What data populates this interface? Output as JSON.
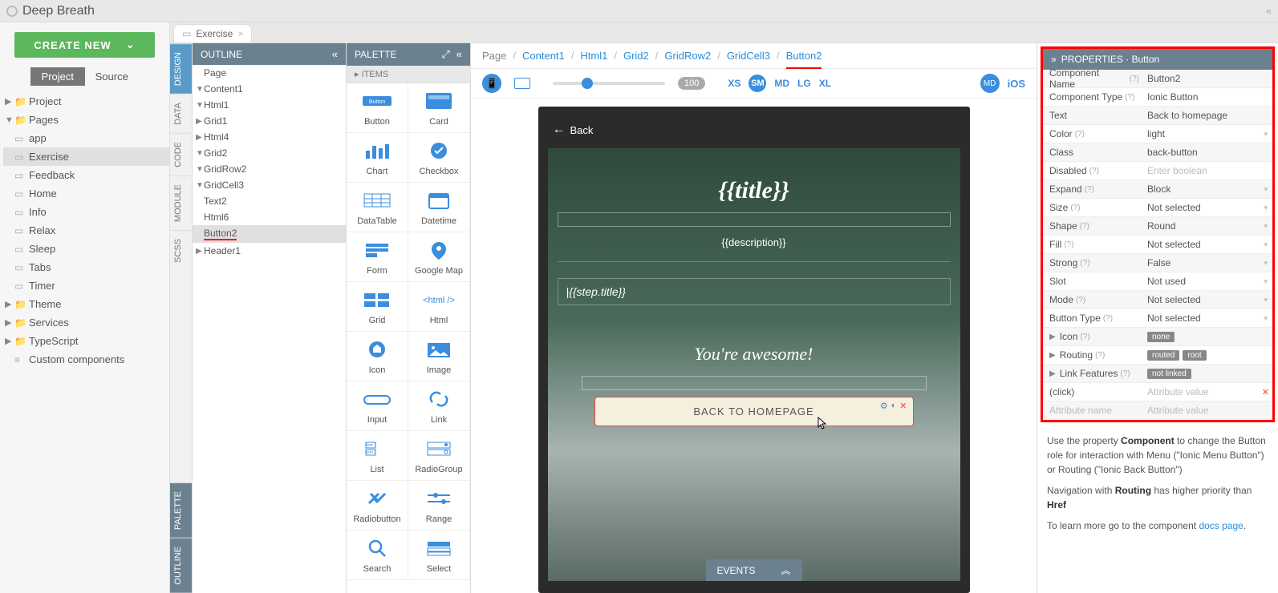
{
  "app": {
    "title": "Deep Breath"
  },
  "left": {
    "create": "CREATE NEW",
    "tabs": {
      "project": "Project",
      "source": "Source"
    },
    "tree": [
      {
        "a": "▶",
        "ico": "📁",
        "label": "Project",
        "ind": 1
      },
      {
        "a": "▼",
        "ico": "📁",
        "label": "Pages",
        "ind": 1
      },
      {
        "a": "",
        "ico": "▭",
        "label": "app",
        "ind": 2
      },
      {
        "a": "",
        "ico": "▭",
        "label": "Exercise",
        "ind": 2,
        "sel": true
      },
      {
        "a": "",
        "ico": "▭",
        "label": "Feedback",
        "ind": 2
      },
      {
        "a": "",
        "ico": "▭",
        "label": "Home",
        "ind": 2
      },
      {
        "a": "",
        "ico": "▭",
        "label": "Info",
        "ind": 2
      },
      {
        "a": "",
        "ico": "▭",
        "label": "Relax",
        "ind": 2
      },
      {
        "a": "",
        "ico": "▭",
        "label": "Sleep",
        "ind": 2
      },
      {
        "a": "",
        "ico": "▭",
        "label": "Tabs",
        "ind": 2
      },
      {
        "a": "",
        "ico": "▭",
        "label": "Timer",
        "ind": 2
      },
      {
        "a": "▶",
        "ico": "📁",
        "label": "Theme",
        "ind": 1
      },
      {
        "a": "▶",
        "ico": "📁",
        "label": "Services",
        "ind": 1
      },
      {
        "a": "▶",
        "ico": "📁",
        "label": "TypeScript",
        "ind": 1
      },
      {
        "a": "",
        "ico": "≡",
        "label": "Custom components",
        "ind": 1
      }
    ]
  },
  "tab": {
    "name": "Exercise"
  },
  "vtabs": [
    "DESIGN",
    "DATA",
    "CODE",
    "MODULE",
    "SCSS",
    "PALETTE",
    "OUTLINE"
  ],
  "outline": {
    "title": "OUTLINE",
    "items": [
      {
        "a": "",
        "ind": 0,
        "label": "Page"
      },
      {
        "a": "▼",
        "ind": 1,
        "label": "Content1"
      },
      {
        "a": "▼",
        "ind": 2,
        "label": "Html1"
      },
      {
        "a": "▶",
        "ind": 3,
        "label": "Grid1"
      },
      {
        "a": "▶",
        "ind": 3,
        "label": "Html4"
      },
      {
        "a": "▼",
        "ind": 3,
        "label": "Grid2"
      },
      {
        "a": "▼",
        "ind": 4,
        "label": "GridRow2"
      },
      {
        "a": "▼",
        "ind": 5,
        "label": "GridCell3"
      },
      {
        "a": "",
        "ind": 6,
        "label": "Text2"
      },
      {
        "a": "",
        "ind": 6,
        "label": "Html6"
      },
      {
        "a": "",
        "ind": 6,
        "label": "Button2",
        "sel": true,
        "u": true
      },
      {
        "a": "▶",
        "ind": 1,
        "label": "Header1"
      }
    ]
  },
  "palette": {
    "title": "PALETTE",
    "sub": "ITEMS",
    "items": [
      "Button",
      "Card",
      "Chart",
      "Checkbox",
      "DataTable",
      "Datetime",
      "Form",
      "Google Map",
      "Grid",
      "Html",
      "Icon",
      "Image",
      "Input",
      "Link",
      "List",
      "RadioGroup",
      "Radiobutton",
      "Range",
      "Search",
      "Select"
    ]
  },
  "bc": [
    "Page",
    "Content1",
    "Html1",
    "Grid2",
    "GridRow2",
    "GridCell3",
    "Button2"
  ],
  "toolbar": {
    "pill": "100",
    "sizes": [
      "XS",
      "SM",
      "MD",
      "LG",
      "XL"
    ],
    "md": "MD",
    "ios": "iOS"
  },
  "preview": {
    "back": "Back",
    "title": "{{title}}",
    "desc": "{{description}}",
    "step": "{{step.title}}",
    "awesome": "You're awesome!",
    "btn": "BACK TO HOMEPAGE"
  },
  "events": "EVENTS",
  "props": {
    "title": "PROPERTIES · Button",
    "rows": [
      {
        "k": "Component Name",
        "q": true,
        "v": "Button2"
      },
      {
        "k": "Component Type",
        "q": true,
        "v": "Ionic Button"
      },
      {
        "k": "Text",
        "v": "Back to homepage"
      },
      {
        "k": "Color",
        "q": true,
        "v": "light",
        "dd": true
      },
      {
        "k": "Class",
        "v": "back-button"
      },
      {
        "k": "Disabled",
        "q": true,
        "v": "Enter boolean",
        "ph": true
      },
      {
        "k": "Expand",
        "q": true,
        "v": "Block",
        "dd": true
      },
      {
        "k": "Size",
        "q": true,
        "v": "Not selected",
        "dd": true
      },
      {
        "k": "Shape",
        "q": true,
        "v": "Round",
        "dd": true
      },
      {
        "k": "Fill",
        "q": true,
        "v": "Not selected",
        "dd": true
      },
      {
        "k": "Strong",
        "q": true,
        "v": "False",
        "dd": true
      },
      {
        "k": "Slot",
        "v": "Not used",
        "dd": true
      },
      {
        "k": "Mode",
        "q": true,
        "v": "Not selected",
        "dd": true
      },
      {
        "k": "Button Type",
        "q": true,
        "v": "Not selected",
        "dd": true
      },
      {
        "k": "Icon",
        "q": true,
        "exp": true,
        "tags": [
          "none"
        ]
      },
      {
        "k": "Routing",
        "q": true,
        "exp": true,
        "tags": [
          "routed",
          "root"
        ]
      },
      {
        "k": "Link Features",
        "q": true,
        "exp": true,
        "tags": [
          "not linked"
        ]
      },
      {
        "k": "(click)",
        "v": "Attribute value",
        "ph": true,
        "x": true
      },
      {
        "k": "Attribute name",
        "kph": true,
        "v": "Attribute value",
        "ph": true
      }
    ],
    "note1a": "Use the property ",
    "note1b": "Component",
    "note1c": " to change the Button role for interaction with Menu (\"Ionic Menu Button\") or Routing (\"Ionic Back Button\")",
    "note2a": "Navigation with ",
    "note2b": "Routing",
    "note2c": " has higher priority than ",
    "note2d": "Href",
    "note3a": "To learn more go to the component ",
    "note3b": "docs page",
    "note3c": "."
  }
}
